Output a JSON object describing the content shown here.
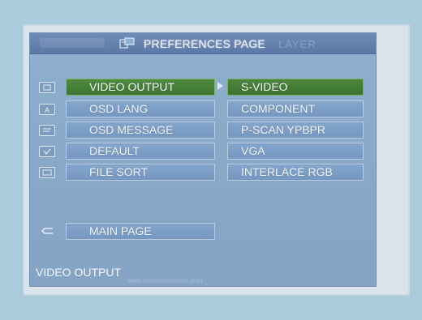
{
  "header": {
    "title": "PREFERENCES  PAGE",
    "ghost_right": "LAYER"
  },
  "left_menu": [
    {
      "label": "VIDEO OUTPUT",
      "icon": "monitor-icon",
      "selected": true
    },
    {
      "label": "OSD LANG",
      "icon": "language-icon",
      "selected": false
    },
    {
      "label": "OSD MESSAGE",
      "icon": "message-icon",
      "selected": false
    },
    {
      "label": "DEFAULT",
      "icon": "checkmark-icon",
      "selected": false
    },
    {
      "label": "FILE SORT",
      "icon": "folder-icon",
      "selected": false
    }
  ],
  "main_page": {
    "label": "MAIN PAGE",
    "icon": "return-icon"
  },
  "options": [
    {
      "label": "S-VIDEO",
      "selected": true
    },
    {
      "label": "COMPONENT",
      "selected": false
    },
    {
      "label": "P-SCAN YPBPR",
      "selected": false
    },
    {
      "label": "VGA",
      "selected": false
    },
    {
      "label": "INTERLACE RGB",
      "selected": false
    }
  ],
  "status": {
    "text": "VIDEO OUTPUT",
    "watermark": "www.xxxxxxxxxxxxxx.com"
  },
  "colors": {
    "background": "#a9cbdb",
    "screen": "#8eafcf",
    "selected": "#4f8a3f",
    "text": "#f4f8fc"
  }
}
